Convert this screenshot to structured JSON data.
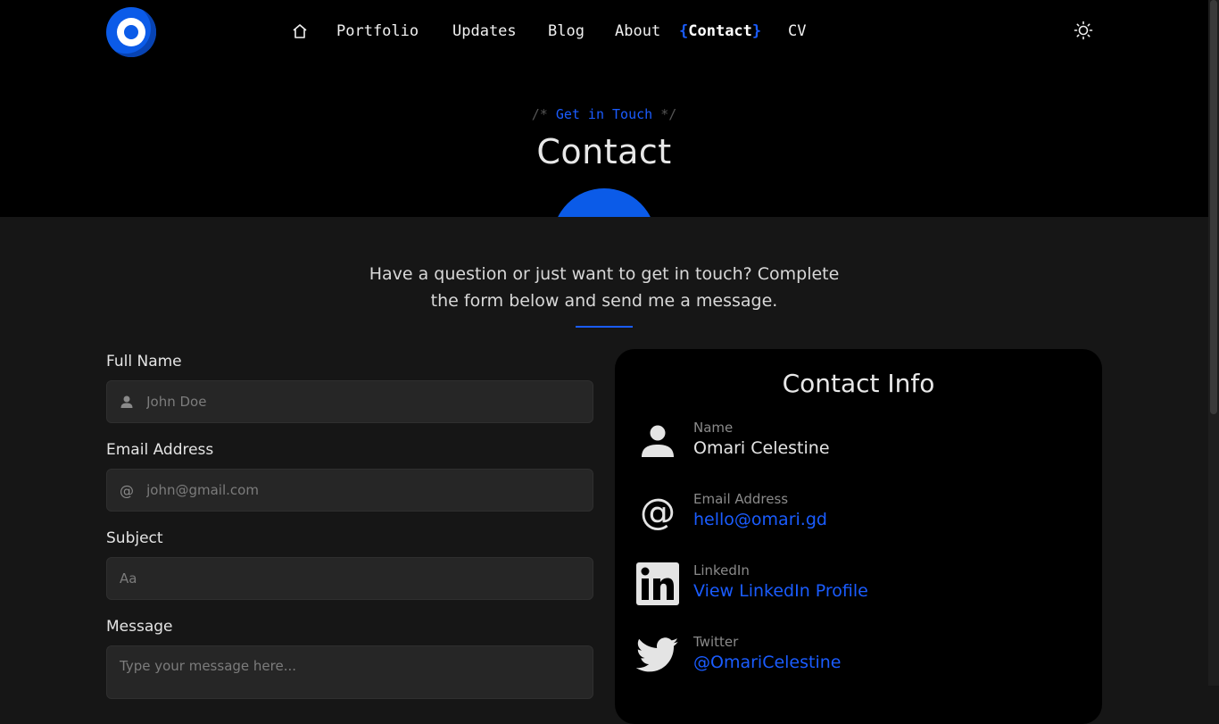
{
  "nav": {
    "home_icon": "home-icon",
    "items": [
      "Portfolio",
      "Updates",
      "Blog",
      "About"
    ],
    "active": {
      "open": "{",
      "label": "Contact",
      "close": "}"
    },
    "last": "CV",
    "theme_icon": "sun-icon"
  },
  "hero": {
    "eyebrow_open": "/*",
    "eyebrow_text": "Get in Touch",
    "eyebrow_close": "*/",
    "title": "Contact"
  },
  "intro": "Have a question or just want to get in touch? Complete the form below and send me a message.",
  "form": {
    "name_label": "Full Name",
    "name_placeholder": "John Doe",
    "email_label": "Email Address",
    "email_icon_glyph": "@",
    "email_placeholder": "john@gmail.com",
    "subject_label": "Subject",
    "subject_placeholder": "Aa",
    "message_label": "Message",
    "message_placeholder": "Type your message here..."
  },
  "contact_info": {
    "title": "Contact Info",
    "rows": [
      {
        "label": "Name",
        "value": "Omari Celestine",
        "icon": "person-icon"
      },
      {
        "label": "Email Address",
        "value": "hello@omari.gd",
        "icon": "at-icon"
      },
      {
        "label": "LinkedIn",
        "value": "View LinkedIn Profile",
        "icon": "linkedin-icon"
      },
      {
        "label": "Twitter",
        "value": "@OmariCelestine",
        "icon": "twitter-icon"
      }
    ]
  },
  "colors": {
    "accent": "#1a5cff",
    "hero_bg": "#000000",
    "page_bg": "#161616",
    "field_bg": "#262626"
  }
}
